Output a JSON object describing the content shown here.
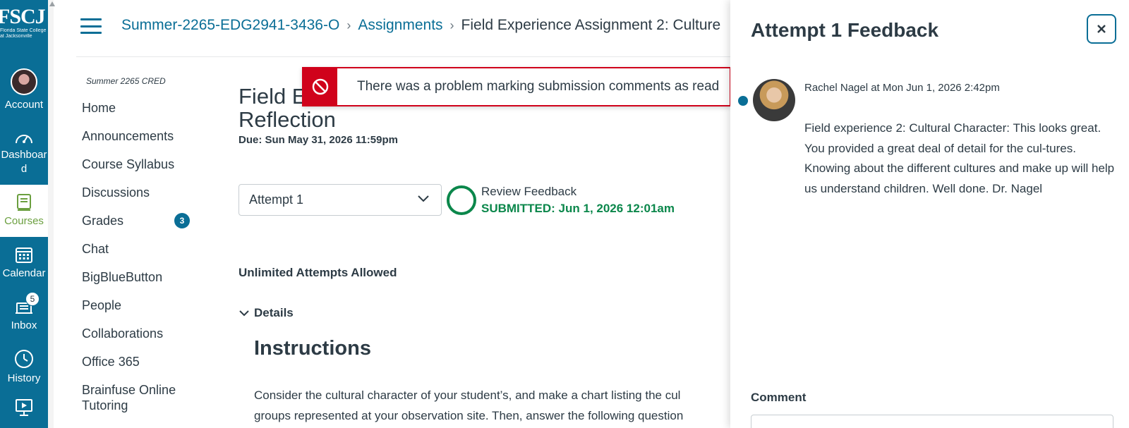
{
  "brand": {
    "logo_text": "FSCJ",
    "logo_subtitle_line1": "Florida State College",
    "logo_subtitle_line2": "at Jacksonville",
    "nav_color": "#0a6e96"
  },
  "global_nav": {
    "account": "Account",
    "dashboard_line1": "Dashboar",
    "dashboard_line2": "d",
    "courses": "Courses",
    "calendar": "Calendar",
    "inbox": "Inbox",
    "inbox_badge": "5",
    "history": "History"
  },
  "breadcrumbs": {
    "course": "Summer-2265-EDG2941-3436-O",
    "section": "Assignments",
    "current": "Field Experience Assignment 2: Culture"
  },
  "course_nav": {
    "term": "Summer 2265 CRED",
    "items": [
      {
        "label": "Home"
      },
      {
        "label": "Announcements"
      },
      {
        "label": "Course Syllabus"
      },
      {
        "label": "Discussions"
      },
      {
        "label": "Grades",
        "badge": "3"
      },
      {
        "label": "Chat"
      },
      {
        "label": "BigBlueButton"
      },
      {
        "label": "People"
      },
      {
        "label": "Collaborations"
      },
      {
        "label": "Office 365"
      },
      {
        "label": "Brainfuse Online Tutoring"
      }
    ]
  },
  "alert": {
    "message": "There was a problem marking submission comments as read"
  },
  "assignment": {
    "title_line1": "Field E",
    "title_line2": "Reflection",
    "due": "Due: Sun May 31, 2026 11:59pm",
    "attempt_selected": "Attempt 1",
    "review_feedback": "Review Feedback",
    "submitted": "SUBMITTED: Jun 1, 2026 12:01am",
    "attempts_allowed": "Unlimited Attempts Allowed",
    "details_label": "Details",
    "instructions_heading": "Instructions",
    "instructions_line1": "Consider the cultural character of your student’s, and make a chart listing the cul",
    "instructions_line2": "groups represented at your observation site. Then, answer the following question"
  },
  "feedback_tray": {
    "title": "Attempt 1 Feedback",
    "comment_author_meta": "Rachel Nagel at Mon Jun 1, 2026 2:42pm",
    "comment_body": "Field experience 2: Cultural Character: This looks great. You provided a great deal of detail for the cul-tures. Knowing about the different cultures and make up will help us understand children. Well done. Dr. Nagel",
    "comment_label": "Comment"
  }
}
